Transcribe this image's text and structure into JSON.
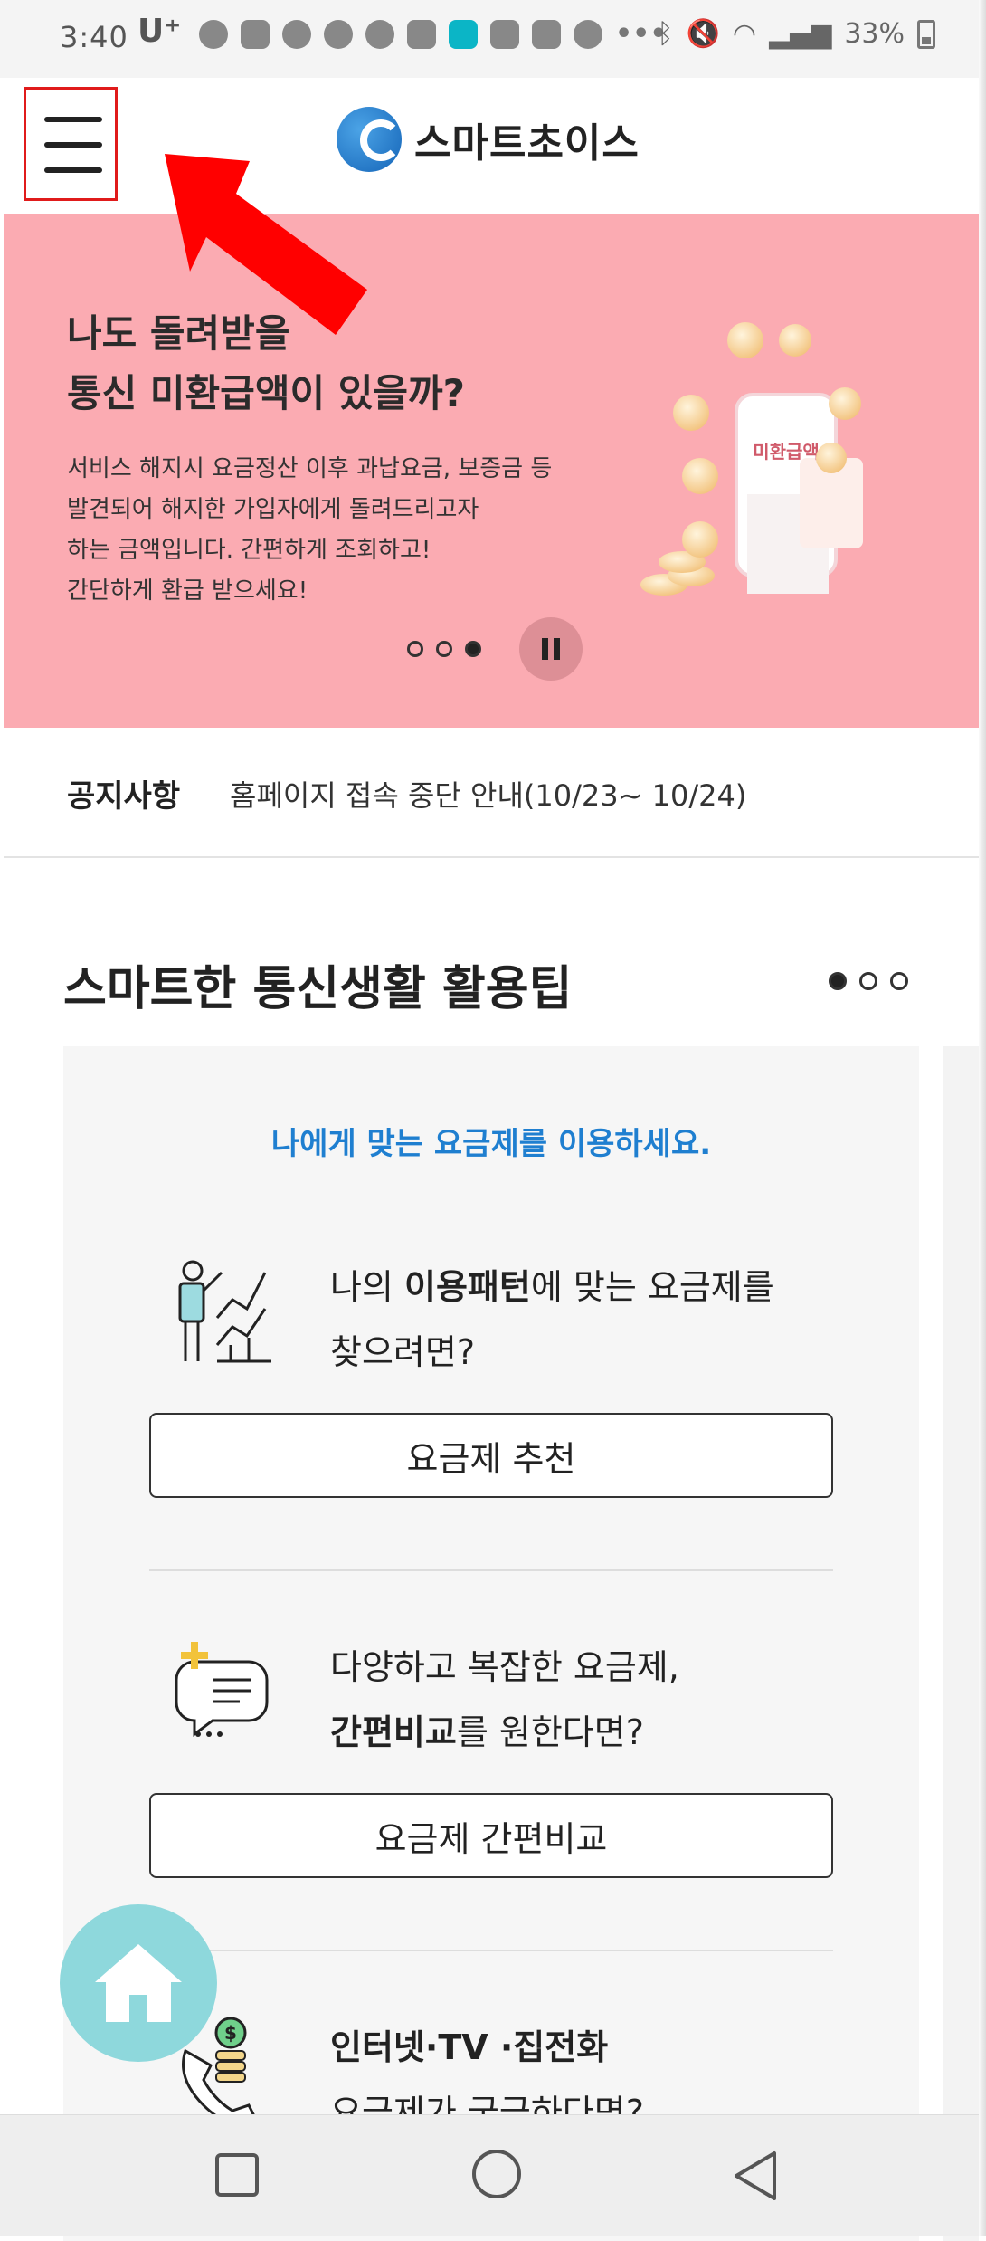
{
  "status_bar": {
    "time": "3:40",
    "carrier": "U⁺",
    "battery_percent": "33%"
  },
  "header": {
    "logo_text": "스마트초이스",
    "menu_label": "menu"
  },
  "banner": {
    "title_line1": "나도 돌려받을",
    "title_line2": "통신 미환급액이 있을까?",
    "desc_line1": "서비스 해지시 요금정산 이후 과납요금, 보증금 등",
    "desc_line2": "발견되어 해지한 가입자에게 돌려드리고자",
    "desc_line3": "하는 금액입니다. 간편하게 조회하고!",
    "desc_line4": "간단하게 환급 받으세요!",
    "illustration_label": "미환급액",
    "slide_index": 3,
    "slide_count": 3
  },
  "notice": {
    "label": "공지사항",
    "text": "홈페이지 접속 중단 안내(10/23~ 10/24)"
  },
  "tips": {
    "title": "스마트한 통신생활 활용팁",
    "page_index": 1,
    "page_count": 3,
    "card_head": "나에게 맞는 요금제를 이용하세요.",
    "items": [
      {
        "text_pre": "나의 ",
        "text_bold": "이용패턴",
        "text_post": "에 맞는 요금제를",
        "text_line2": "찾으려면?",
        "button": "요금제 추천",
        "icon": "presentation-chart-icon"
      },
      {
        "text_line1": "다양하고 복잡한 요금제,",
        "text_bold": "간편비교",
        "text_post": "를 원한다면?",
        "button": "요금제 간편비교",
        "icon": "chat-compare-icon"
      },
      {
        "text_bold": "인터넷·TV ·집전화",
        "text_line2": "요금제가 궁금하다면?",
        "icon": "phone-coin-icon"
      }
    ]
  },
  "colors": {
    "banner_bg": "#fbabb2",
    "accent_blue": "#1f7fd0",
    "fab_bg": "#8ed8dc",
    "highlight_red": "#e01b1b"
  }
}
